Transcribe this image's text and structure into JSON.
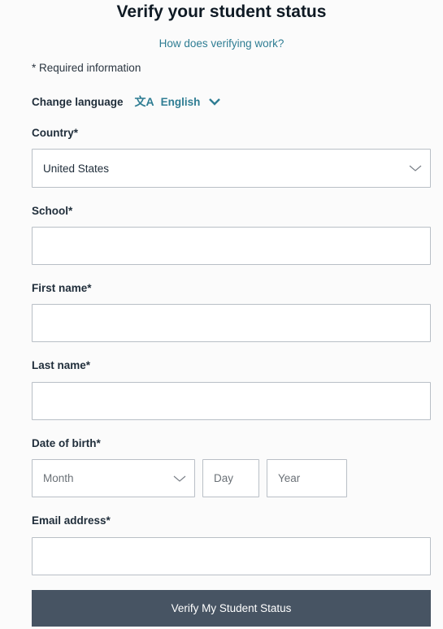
{
  "form": {
    "title": "Verify your student status",
    "how_link": "How does verifying work?",
    "required_note": "* Required information",
    "language": {
      "label": "Change language",
      "icon_text": "文A",
      "value": "English"
    },
    "country": {
      "label": "Country*",
      "value": "United States"
    },
    "school": {
      "label": "School*",
      "value": ""
    },
    "first_name": {
      "label": "First name*",
      "value": ""
    },
    "last_name": {
      "label": "Last name*",
      "value": ""
    },
    "dob": {
      "label": "Date of birth*",
      "month_placeholder": "Month",
      "day_placeholder": "Day",
      "year_placeholder": "Year"
    },
    "email": {
      "label": "Email address*",
      "value": ""
    },
    "submit_label": "Verify My Student Status"
  },
  "colors": {
    "accent": "#2f7d93",
    "button_bg": "#475463",
    "border": "#b9bfc6",
    "background": "#fbfbfb"
  },
  "icons": {
    "language": "translate-icon",
    "language_chevron": "chevron-down-icon",
    "select_chevron": "chevron-down-icon"
  }
}
